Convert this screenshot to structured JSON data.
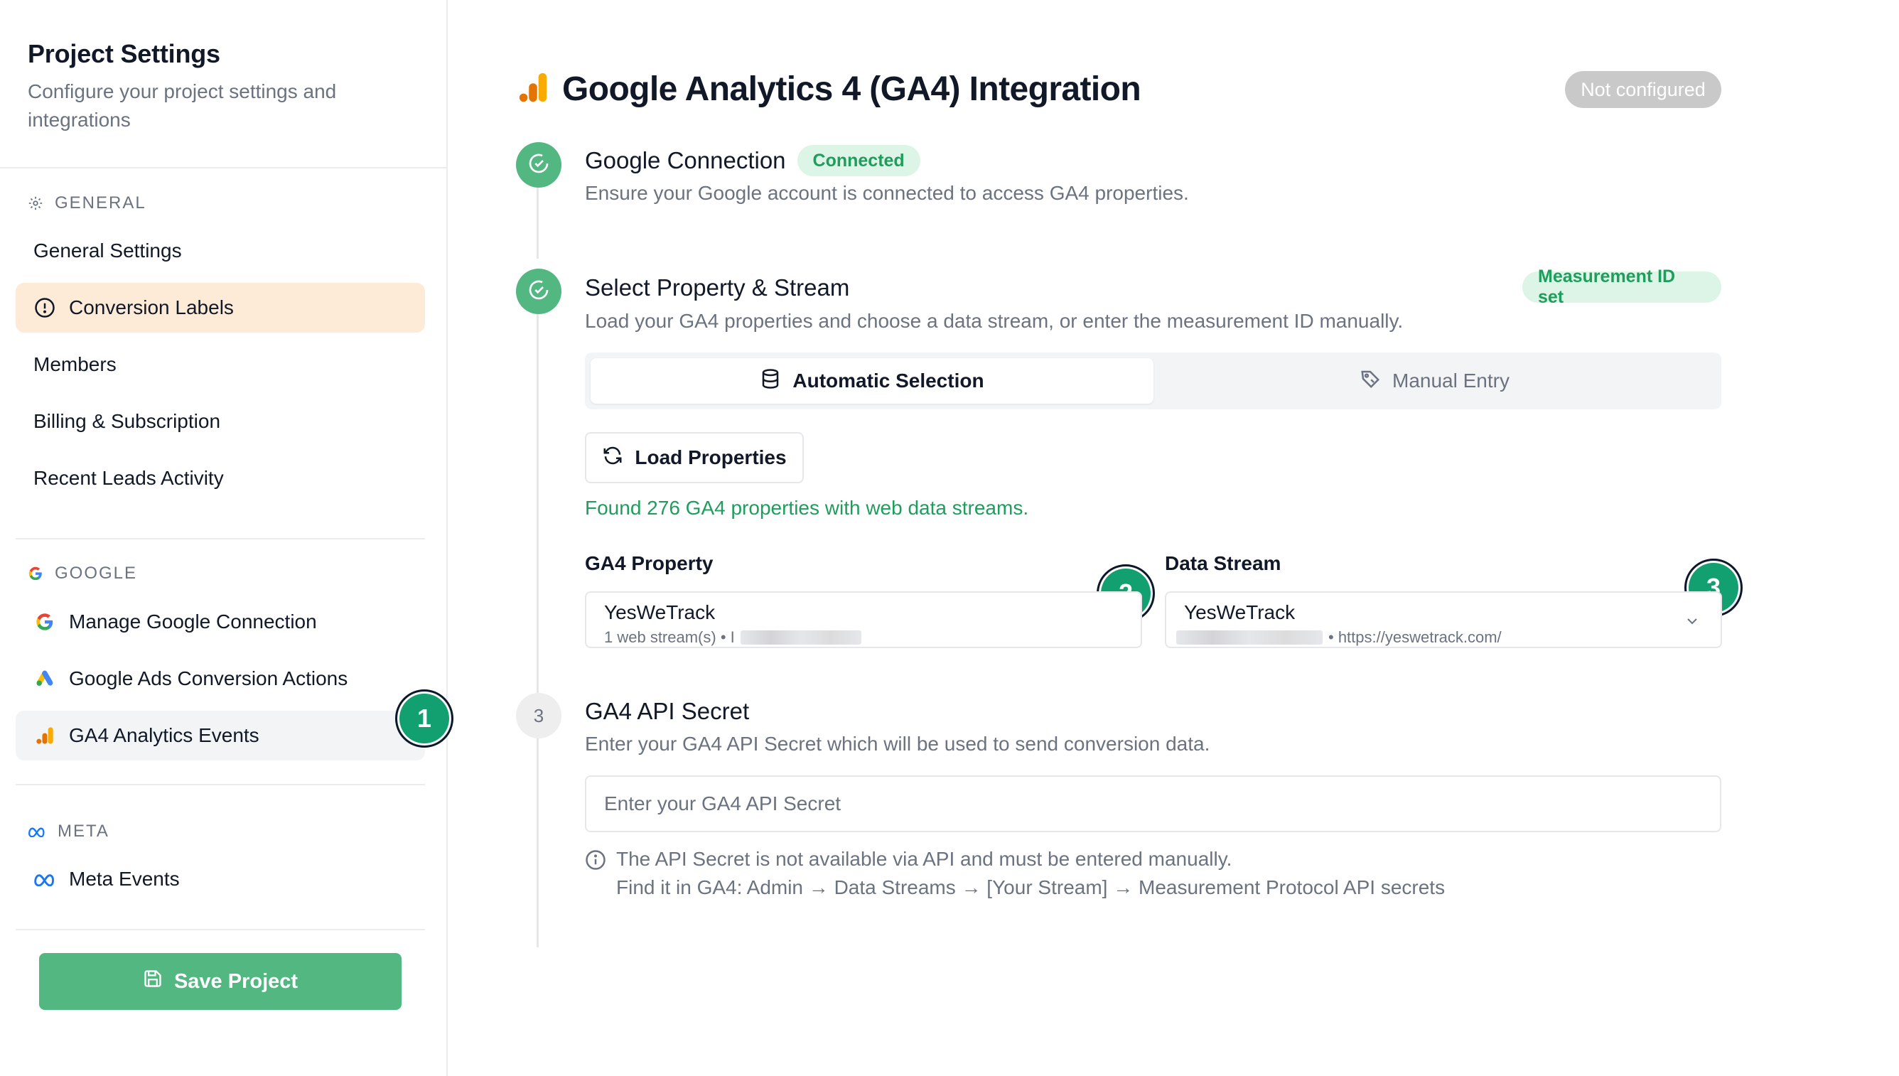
{
  "sidebar": {
    "title": "Project Settings",
    "subtitle": "Configure your project settings and integrations",
    "sections": {
      "general": "GENERAL",
      "google": "GOOGLE",
      "meta": "META"
    },
    "general_items": [
      "General Settings",
      "Conversion Labels",
      "Members",
      "Billing & Subscription",
      "Recent Leads Activity"
    ],
    "google_items": [
      "Manage Google Connection",
      "Google Ads Conversion Actions",
      "GA4 Analytics Events"
    ],
    "meta_items": [
      "Meta Events"
    ],
    "save_label": "Save Project"
  },
  "badges": [
    "1",
    "2",
    "3"
  ],
  "main": {
    "title": "Google Analytics 4 (GA4) Integration",
    "status": "Not configured",
    "steps": [
      {
        "title": "Google Connection",
        "badge": "Connected",
        "description": "Ensure your Google account is connected to access GA4 properties."
      },
      {
        "title": "Select Property & Stream",
        "badge": "Measurement ID set",
        "description": "Load your GA4 properties and choose a data stream, or enter the measurement ID manually."
      },
      {
        "number": "3",
        "title": "GA4 API Secret",
        "description": "Enter your GA4 API Secret which will be used to send conversion data."
      }
    ],
    "tabs": {
      "automatic": "Automatic Selection",
      "manual": "Manual Entry"
    },
    "load_button": "Load Properties",
    "found_text": "Found 276 GA4 properties with web data streams.",
    "property": {
      "label": "GA4 Property",
      "value": "YesWeTrack",
      "sub": "1 web stream(s) • I"
    },
    "stream": {
      "label": "Data Stream",
      "value": "YesWeTrack",
      "sub": "• https://yeswetrack.com/"
    },
    "secret": {
      "placeholder": "Enter your GA4 API Secret",
      "info_line1": "The API Secret is not available via API and must be entered manually.",
      "info_line2": "Find it in GA4: Admin → Data Streams → [Your Stream] → Measurement Protocol API secrets"
    }
  },
  "colors": {
    "accent_green": "#53b782",
    "badge_green": "#13a070",
    "active_orange_bg": "#fdebd7",
    "ga_orange": "#f9ab00",
    "ga_dark_orange": "#e37400"
  }
}
